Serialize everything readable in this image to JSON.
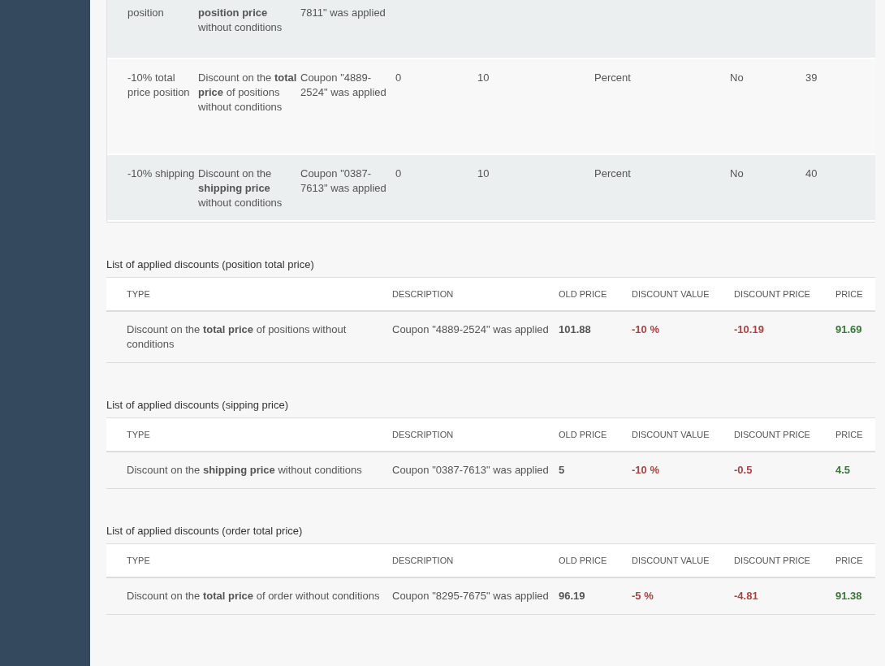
{
  "discounts_table": {
    "rows": [
      {
        "name": "position",
        "description": "**position price** without conditions",
        "info": "7811\" was applied",
        "cells": []
      },
      {
        "name": "-10% total price position",
        "description": "Discount on the **total price** of positions without conditions",
        "info": "Coupon \"4889-2524\" was applied",
        "cells": [
          "0",
          "10",
          "Percent",
          "No",
          "39"
        ]
      },
      {
        "name": "-10% shipping",
        "description": "Discount on the **shipping price** without conditions",
        "info": "Coupon \"0387-7613\" was applied",
        "cells": [
          "0",
          "10",
          "Percent",
          "No",
          "40"
        ]
      }
    ]
  },
  "applied_lists": [
    {
      "title": "List of applied discounts (position total price)",
      "columns": [
        "TYPE",
        "DESCRIPTION",
        "OLD PRICE",
        "DISCOUNT VALUE",
        "DISCOUNT PRICE",
        "PRICE"
      ],
      "rows": [
        {
          "type": "Discount on the **total price** of positions without conditions",
          "description": "Coupon \"4889-2524\" was applied",
          "old_price": "101.88",
          "discount_value": "-10 %",
          "discount_price": "-10.19",
          "price": "91.69"
        }
      ]
    },
    {
      "title": "List of applied discounts (sipping price)",
      "columns": [
        "TYPE",
        "DESCRIPTION",
        "OLD PRICE",
        "DISCOUNT VALUE",
        "DISCOUNT PRICE",
        "PRICE"
      ],
      "rows": [
        {
          "type": "Discount on the **shipping price** without conditions",
          "description": "Coupon \"0387-7613\" was applied",
          "old_price": "5",
          "discount_value": "-10 %",
          "discount_price": "-0.5",
          "price": "4.5"
        }
      ]
    },
    {
      "title": "List of applied discounts (order total price)",
      "columns": [
        "TYPE",
        "DESCRIPTION",
        "OLD PRICE",
        "DISCOUNT VALUE",
        "DISCOUNT PRICE",
        "PRICE"
      ],
      "rows": [
        {
          "type": "Discount on the **total price** of order without conditions",
          "description": "Coupon \"8295-7675\" was applied",
          "old_price": "96.19",
          "discount_value": "-5 %",
          "discount_price": "-4.81",
          "price": "91.38"
        }
      ]
    }
  ]
}
